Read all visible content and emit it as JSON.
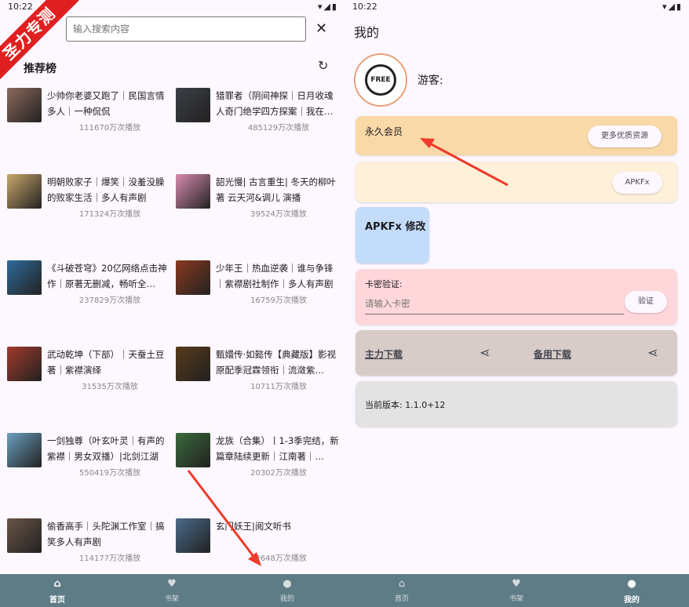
{
  "colors": {
    "accent": "#ee3b2b",
    "nav_bg": "#5e7c86",
    "vip_card": "#fad9a8",
    "apkfx_card": "#fff1d9",
    "mod_card": "#c3dcf9",
    "card_verify": "#ffd7db",
    "download_card": "#d8ccc9",
    "version_card": "#e3e3e3",
    "watermark": "#e02020"
  },
  "left": {
    "status_time": "10:22",
    "watermark": "圣力专测",
    "search": {
      "placeholder": "输入搜索内容"
    },
    "ranking_title": "推荐榜",
    "items": [
      {
        "title": "少帅你老婆又跑了｜民国言情多人｜一种侃侃",
        "plays": "111670万次播放",
        "cover": "#8c6a5d"
      },
      {
        "title": "猎罪者（阴间神探｜日月收魂人奇门绝学四方探案｜我在…",
        "plays": "485129万次播放",
        "cover": "#3c3f47"
      },
      {
        "title": "明朝败家子｜爆笑｜没羞没臊的败家生活｜多人有声剧",
        "plays": "171324万次播放",
        "cover": "#c9a66b"
      },
      {
        "title": "韶光慢| 古言重生| 冬天的柳叶著 云天河&调儿 演播",
        "plays": "39524万次播放",
        "cover": "#d98cb0"
      },
      {
        "title": "《斗破苍穹》20亿网络点击神作｜原著无删减，畅听全…",
        "plays": "237829万次播放",
        "cover": "#2f6a9a"
      },
      {
        "title": "少年王｜热血逆袭｜谁与争锋｜紫襟剧社制作｜多人有声剧",
        "plays": "16759万次播放",
        "cover": "#8a3a1e"
      },
      {
        "title": "武动乾坤（下部）｜天蚕土豆著｜紫襟演绎",
        "plays": "31535万次播放",
        "cover": "#a23a2a"
      },
      {
        "title": "甄嬛传·如懿传【典藏版】影视原配季冠霖领衔｜流潋紫…",
        "plays": "10711万次播放",
        "cover": "#5a3a1a"
      },
      {
        "title": "一剑独尊（叶玄叶灵｜有声的紫襟｜男女双播）|北剑江湖",
        "plays": "550419万次播放",
        "cover": "#6aa0c0"
      },
      {
        "title": "龙族（合集）丨1-3季完结，新篇章陆续更新｜江南著｜…",
        "plays": "20302万次播放",
        "cover": "#3a6a3a"
      },
      {
        "title": "偷香高手｜头陀渊工作室｜搞笑多人有声剧",
        "plays": "114177万次播放",
        "cover": "#6a5548"
      },
      {
        "title": "玄门妖王|阅文听书",
        "plays": "12648万次播放",
        "cover": "#4a6a8a"
      }
    ],
    "nav": [
      {
        "label": "首页",
        "icon": "home-icon"
      },
      {
        "label": "书架",
        "icon": "heart-icon"
      },
      {
        "label": "我的",
        "icon": "person-icon"
      }
    ]
  },
  "right": {
    "status_time": "10:22",
    "page_title": "我的",
    "avatar_text": "FREE",
    "guest_label": "游客:",
    "vip_label": "永久会员",
    "more_resources_button": "更多优质资源",
    "apkfx_button": "APKFx",
    "mod_label": "APKFx 修改",
    "card_verify_label": "卡密验证:",
    "card_input_placeholder": "请输入卡密",
    "verify_button": "验证",
    "main_download": "主力下载",
    "backup_download": "备用下载",
    "version_label": "当前版本: 1.1.0+12",
    "nav": [
      {
        "label": "首页",
        "icon": "home-icon"
      },
      {
        "label": "书架",
        "icon": "heart-icon"
      },
      {
        "label": "我的",
        "icon": "person-icon"
      }
    ]
  }
}
